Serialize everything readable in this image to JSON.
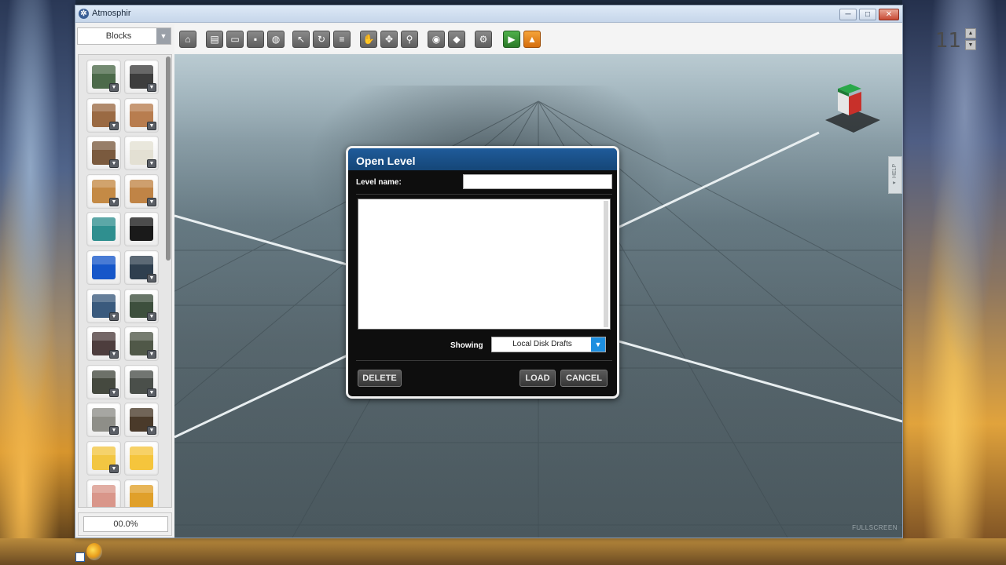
{
  "window": {
    "title": "Atmosphir",
    "minimize_glyph": "─",
    "maximize_glyph": "□",
    "close_glyph": "✕",
    "app_icon_glyph": "✲"
  },
  "palette": {
    "category": "Blocks",
    "dropdown_glyph": "▼",
    "progress": "00.0%",
    "variant_glyph": "▼",
    "blocks": [
      {
        "color": "#4c6a4a",
        "variant": true
      },
      {
        "color": "#3d3d3d",
        "variant": true
      },
      {
        "color": "#9a6a43",
        "variant": true
      },
      {
        "color": "#b87d4f",
        "variant": true
      },
      {
        "color": "#7a5a3e",
        "variant": true
      },
      {
        "color": "#e3e0d3",
        "variant": true
      },
      {
        "color": "#c48a45",
        "variant": true
      },
      {
        "color": "#c08446",
        "variant": true
      },
      {
        "color": "#2f8f8f",
        "variant": false
      },
      {
        "color": "#1a1a1a",
        "variant": false
      },
      {
        "color": "#1556c9",
        "variant": false
      },
      {
        "color": "#2f3f4f",
        "variant": true
      },
      {
        "color": "#3a5a7d",
        "variant": true
      },
      {
        "color": "#3d4f3d",
        "variant": true
      },
      {
        "color": "#4d3d3d",
        "variant": true
      },
      {
        "color": "#505848",
        "variant": true
      },
      {
        "color": "#45493f",
        "variant": true
      },
      {
        "color": "#4a4f4a",
        "variant": true
      },
      {
        "color": "#8e8e88",
        "variant": true
      },
      {
        "color": "#4a3a2a",
        "variant": true
      },
      {
        "color": "#f2c642",
        "variant": true
      },
      {
        "color": "#f5c53c",
        "variant": false
      },
      {
        "color": "#d9968a",
        "variant": false
      },
      {
        "color": "#e0a02a",
        "variant": false
      }
    ]
  },
  "toolbar": {
    "tools": [
      {
        "name": "home-icon",
        "glyph": "⌂"
      },
      {
        "name": "new-file-icon",
        "glyph": "▤"
      },
      {
        "name": "open-folder-icon",
        "glyph": "▭"
      },
      {
        "name": "save-icon",
        "glyph": "▪"
      },
      {
        "name": "globe-icon",
        "glyph": "◍"
      },
      {
        "name": "select-arrow-icon",
        "glyph": "↖"
      },
      {
        "name": "rotate-icon",
        "glyph": "↻"
      },
      {
        "name": "list-icon",
        "glyph": "≡"
      },
      {
        "name": "hand-icon",
        "glyph": "✋"
      },
      {
        "name": "move-icon",
        "glyph": "✥"
      },
      {
        "name": "zoom-icon",
        "glyph": "⚲"
      },
      {
        "name": "eye-icon",
        "glyph": "◉"
      },
      {
        "name": "eraser-icon",
        "glyph": "◆"
      },
      {
        "name": "gear-icon",
        "glyph": "⚙"
      },
      {
        "name": "play-icon",
        "glyph": "▶"
      },
      {
        "name": "warning-icon",
        "glyph": "▲"
      }
    ],
    "counter": "11",
    "spin_up": "▲",
    "spin_down": "▼"
  },
  "viewport": {
    "fullscreen_label": "FULLSCREEN",
    "help_label": "◂ HELP"
  },
  "dialog": {
    "title": "Open Level",
    "level_name_label": "Level name:",
    "level_name_value": "",
    "showing_label": "Showing",
    "showing_value": "Local Disk Drafts",
    "showing_arrow": "▼",
    "delete_label": "DELETE",
    "load_label": "LOAD",
    "cancel_label": "CANCEL",
    "levels": []
  },
  "colors": {
    "dialog_title_bg": "#1a5290",
    "select_arrow_bg": "#1d8fe0",
    "play_green": "#3a9a35",
    "warn_orange": "#e8861e"
  }
}
